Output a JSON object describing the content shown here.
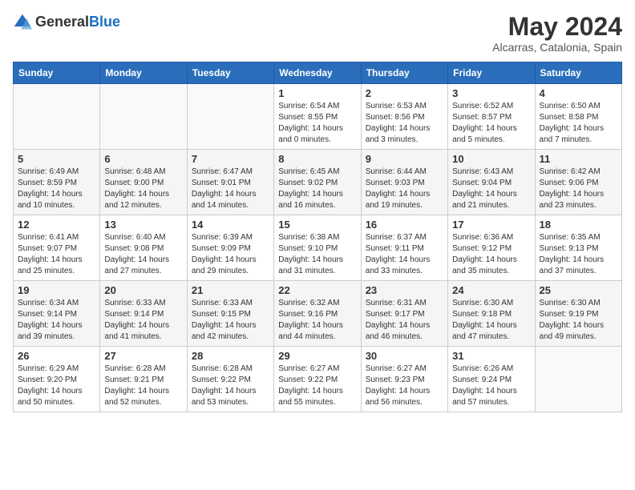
{
  "logo": {
    "text_general": "General",
    "text_blue": "Blue"
  },
  "header": {
    "month": "May 2024",
    "location": "Alcarras, Catalonia, Spain"
  },
  "weekdays": [
    "Sunday",
    "Monday",
    "Tuesday",
    "Wednesday",
    "Thursday",
    "Friday",
    "Saturday"
  ],
  "weeks": [
    [
      {
        "day": "",
        "info": ""
      },
      {
        "day": "",
        "info": ""
      },
      {
        "day": "",
        "info": ""
      },
      {
        "day": "1",
        "info": "Sunrise: 6:54 AM\nSunset: 8:55 PM\nDaylight: 14 hours\nand 0 minutes."
      },
      {
        "day": "2",
        "info": "Sunrise: 6:53 AM\nSunset: 8:56 PM\nDaylight: 14 hours\nand 3 minutes."
      },
      {
        "day": "3",
        "info": "Sunrise: 6:52 AM\nSunset: 8:57 PM\nDaylight: 14 hours\nand 5 minutes."
      },
      {
        "day": "4",
        "info": "Sunrise: 6:50 AM\nSunset: 8:58 PM\nDaylight: 14 hours\nand 7 minutes."
      }
    ],
    [
      {
        "day": "5",
        "info": "Sunrise: 6:49 AM\nSunset: 8:59 PM\nDaylight: 14 hours\nand 10 minutes."
      },
      {
        "day": "6",
        "info": "Sunrise: 6:48 AM\nSunset: 9:00 PM\nDaylight: 14 hours\nand 12 minutes."
      },
      {
        "day": "7",
        "info": "Sunrise: 6:47 AM\nSunset: 9:01 PM\nDaylight: 14 hours\nand 14 minutes."
      },
      {
        "day": "8",
        "info": "Sunrise: 6:45 AM\nSunset: 9:02 PM\nDaylight: 14 hours\nand 16 minutes."
      },
      {
        "day": "9",
        "info": "Sunrise: 6:44 AM\nSunset: 9:03 PM\nDaylight: 14 hours\nand 19 minutes."
      },
      {
        "day": "10",
        "info": "Sunrise: 6:43 AM\nSunset: 9:04 PM\nDaylight: 14 hours\nand 21 minutes."
      },
      {
        "day": "11",
        "info": "Sunrise: 6:42 AM\nSunset: 9:06 PM\nDaylight: 14 hours\nand 23 minutes."
      }
    ],
    [
      {
        "day": "12",
        "info": "Sunrise: 6:41 AM\nSunset: 9:07 PM\nDaylight: 14 hours\nand 25 minutes."
      },
      {
        "day": "13",
        "info": "Sunrise: 6:40 AM\nSunset: 9:08 PM\nDaylight: 14 hours\nand 27 minutes."
      },
      {
        "day": "14",
        "info": "Sunrise: 6:39 AM\nSunset: 9:09 PM\nDaylight: 14 hours\nand 29 minutes."
      },
      {
        "day": "15",
        "info": "Sunrise: 6:38 AM\nSunset: 9:10 PM\nDaylight: 14 hours\nand 31 minutes."
      },
      {
        "day": "16",
        "info": "Sunrise: 6:37 AM\nSunset: 9:11 PM\nDaylight: 14 hours\nand 33 minutes."
      },
      {
        "day": "17",
        "info": "Sunrise: 6:36 AM\nSunset: 9:12 PM\nDaylight: 14 hours\nand 35 minutes."
      },
      {
        "day": "18",
        "info": "Sunrise: 6:35 AM\nSunset: 9:13 PM\nDaylight: 14 hours\nand 37 minutes."
      }
    ],
    [
      {
        "day": "19",
        "info": "Sunrise: 6:34 AM\nSunset: 9:14 PM\nDaylight: 14 hours\nand 39 minutes."
      },
      {
        "day": "20",
        "info": "Sunrise: 6:33 AM\nSunset: 9:14 PM\nDaylight: 14 hours\nand 41 minutes."
      },
      {
        "day": "21",
        "info": "Sunrise: 6:33 AM\nSunset: 9:15 PM\nDaylight: 14 hours\nand 42 minutes."
      },
      {
        "day": "22",
        "info": "Sunrise: 6:32 AM\nSunset: 9:16 PM\nDaylight: 14 hours\nand 44 minutes."
      },
      {
        "day": "23",
        "info": "Sunrise: 6:31 AM\nSunset: 9:17 PM\nDaylight: 14 hours\nand 46 minutes."
      },
      {
        "day": "24",
        "info": "Sunrise: 6:30 AM\nSunset: 9:18 PM\nDaylight: 14 hours\nand 47 minutes."
      },
      {
        "day": "25",
        "info": "Sunrise: 6:30 AM\nSunset: 9:19 PM\nDaylight: 14 hours\nand 49 minutes."
      }
    ],
    [
      {
        "day": "26",
        "info": "Sunrise: 6:29 AM\nSunset: 9:20 PM\nDaylight: 14 hours\nand 50 minutes."
      },
      {
        "day": "27",
        "info": "Sunrise: 6:28 AM\nSunset: 9:21 PM\nDaylight: 14 hours\nand 52 minutes."
      },
      {
        "day": "28",
        "info": "Sunrise: 6:28 AM\nSunset: 9:22 PM\nDaylight: 14 hours\nand 53 minutes."
      },
      {
        "day": "29",
        "info": "Sunrise: 6:27 AM\nSunset: 9:22 PM\nDaylight: 14 hours\nand 55 minutes."
      },
      {
        "day": "30",
        "info": "Sunrise: 6:27 AM\nSunset: 9:23 PM\nDaylight: 14 hours\nand 56 minutes."
      },
      {
        "day": "31",
        "info": "Sunrise: 6:26 AM\nSunset: 9:24 PM\nDaylight: 14 hours\nand 57 minutes."
      },
      {
        "day": "",
        "info": ""
      }
    ]
  ]
}
